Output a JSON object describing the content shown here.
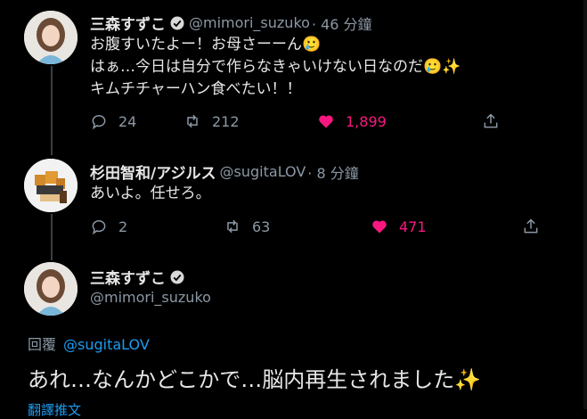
{
  "tweet1": {
    "name": "三森すずこ",
    "handle": "@mimori_suzuko",
    "time": "· 46 分鐘",
    "lines": [
      "お腹すいたよー！お母さーーん🥲",
      "はぁ…今日は自分で作らなきゃいけない日なのだ🥲✨",
      "キムチチャーハン食べたい！！"
    ],
    "replies": "24",
    "retweets": "212",
    "likes": "1,899"
  },
  "tweet2": {
    "name": "杉田智和/アジルス",
    "handle": "@sugitaLOV",
    "time": "· 8 分鐘",
    "text": "あいよ。任せろ。",
    "replies": "2",
    "retweets": "63",
    "likes": "471"
  },
  "main_tweet": {
    "name": "三森すずこ",
    "handle": "@mimori_suzuko",
    "reply_label": "回覆",
    "reply_to": "@sugitaLOV",
    "text": "あれ…なんかどこかで…脳内再生されました✨",
    "translate_label": "翻譯推文"
  },
  "colors": {
    "background": "#000000",
    "like": "#f91880",
    "link": "#1d9bf0",
    "muted": "#8b98a5"
  },
  "icons": [
    "reply-icon",
    "retweet-icon",
    "like-icon",
    "share-icon",
    "verified-badge-icon"
  ]
}
